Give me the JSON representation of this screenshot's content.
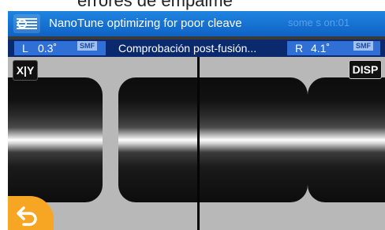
{
  "caption": "errores de empalme",
  "header": {
    "title": "NanoTune optimizing for poor cleave",
    "faded_text": "some s  on:01"
  },
  "status": {
    "left": {
      "label": "L",
      "angle": "0.3˚",
      "type": "SMF"
    },
    "center": "Comprobación post-fusión...",
    "right": {
      "label": "R",
      "angle": "4.1˚",
      "type": "SMF"
    }
  },
  "buttons": {
    "xy_label": "X|Y",
    "disp_label": "DISP"
  },
  "icons": {
    "logo": "fiber-logo-icon",
    "back": "back-arrow-icon"
  },
  "colors": {
    "accent": "#1576d6",
    "back_button": "#f6a623"
  }
}
